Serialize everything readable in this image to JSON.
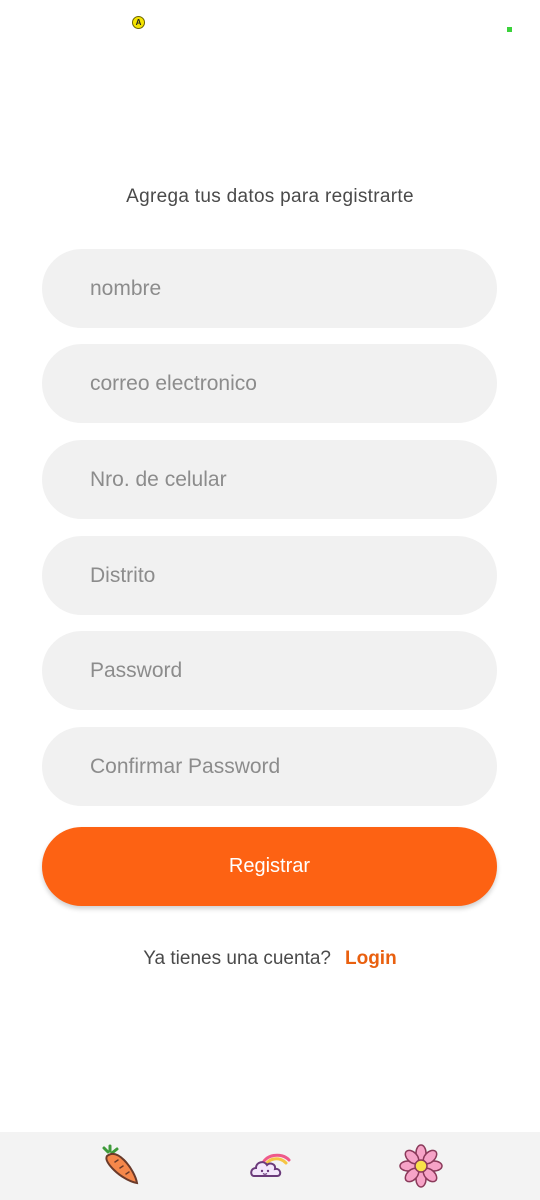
{
  "status_bar": {
    "indicator_letter": "A"
  },
  "form": {
    "subtitle": "Agrega tus datos para registrarte",
    "fields": [
      {
        "placeholder": "nombre",
        "value": ""
      },
      {
        "placeholder": "correo electronico",
        "value": ""
      },
      {
        "placeholder": "Nro. de celular",
        "value": ""
      },
      {
        "placeholder": "Distrito",
        "value": ""
      },
      {
        "placeholder": "Password",
        "value": ""
      },
      {
        "placeholder": "Confirmar Password",
        "value": ""
      }
    ],
    "submit_label": "Registrar"
  },
  "login_prompt": {
    "text": "Ya tienes una cuenta?",
    "link_label": "Login"
  },
  "bottom_nav": {
    "items": [
      {
        "icon": "carrot-icon"
      },
      {
        "icon": "rainbow-cloud-icon"
      },
      {
        "icon": "flower-icon"
      }
    ]
  },
  "colors": {
    "accent": "#fd6213",
    "link": "#e9600f",
    "field_bg": "#f1f1f1",
    "nav_bg": "#f3f3f3"
  }
}
